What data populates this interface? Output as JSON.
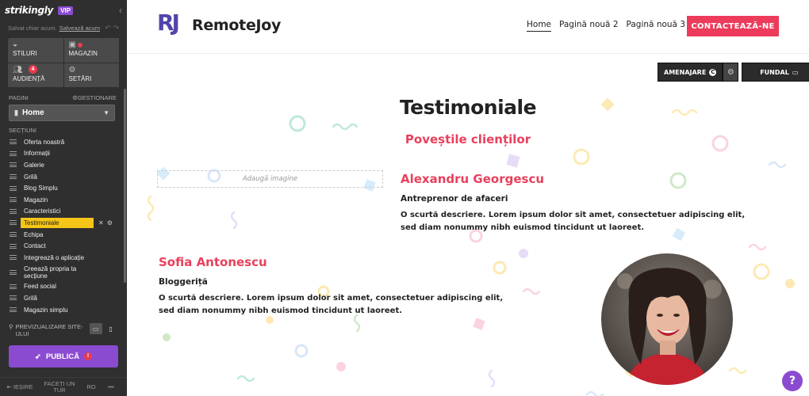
{
  "editor": {
    "logo": "strikingly",
    "vip": "VIP",
    "saved_text": "Salvat chiar acum.",
    "save_now": "Salvează acum",
    "quick": [
      {
        "label": "Stiluri",
        "icon": "palette-icon"
      },
      {
        "label": "Magazin",
        "icon": "shop-icon"
      },
      {
        "label": "Audiență",
        "icon": "people-icon",
        "badge": "4"
      },
      {
        "label": "Setări",
        "icon": "gear-icon"
      }
    ],
    "pages_label": "Pagini",
    "manage_label": "Gestionare",
    "current_page": "Home",
    "sections_label": "Secțiuni",
    "sections": [
      "Oferta noastră",
      "Informații",
      "Galerie",
      "Grilă",
      "Blog Simplu",
      "Magazin",
      "Caracteristici",
      "Testimoniale",
      "Echipa",
      "Contact",
      "Integrează o aplicație",
      "Creează propria ta secțiune",
      "Feed social",
      "Grilă",
      "Magazin simplu"
    ],
    "active_section": "Testimoniale",
    "preview_label": "Previzualizare site-ului",
    "publish_label": "Publică",
    "publish_warn": "!",
    "footer": {
      "exit": "Ieșire",
      "tour": "Faceți un tur",
      "lang": "RO",
      "more": "•••"
    }
  },
  "site": {
    "brand_mark": "RJ",
    "brand": "RemoteJoy",
    "nav": [
      "Home",
      "Pagină nouă 2",
      "Pagină nouă 3"
    ],
    "cta": "Contactează-ne",
    "tools": {
      "layout": "Amenajare",
      "layout_badge": "C",
      "background": "Fundal"
    },
    "section_title": "Testimoniale",
    "section_subtitle": "Poveștile clienților",
    "add_image": "Adaugă imagine",
    "testimonials": [
      {
        "name": "Alexandru Georgescu",
        "role": "Antreprenor de afaceri",
        "description": "O scurtă descriere. Lorem ipsum dolor sit amet, consectetuer adipiscing elit, sed diam nonummy nibh euismod tincidunt ut laoreet."
      },
      {
        "name": "Sofia Antonescu",
        "role": "Bloggeriță",
        "description": "O scurtă descriere. Lorem ipsum dolor sit amet, consectetuer adipiscing elit, sed diam nonummy nibh euismod tincidunt ut laoreet."
      }
    ],
    "help": "?"
  },
  "colors": {
    "accent": "#e8405c",
    "cta": "#ec3b5b",
    "brand": "#5046a8",
    "publish": "#8a4bd1",
    "active_section": "#f5c518",
    "sidebar_bg": "#2f2f2f"
  }
}
